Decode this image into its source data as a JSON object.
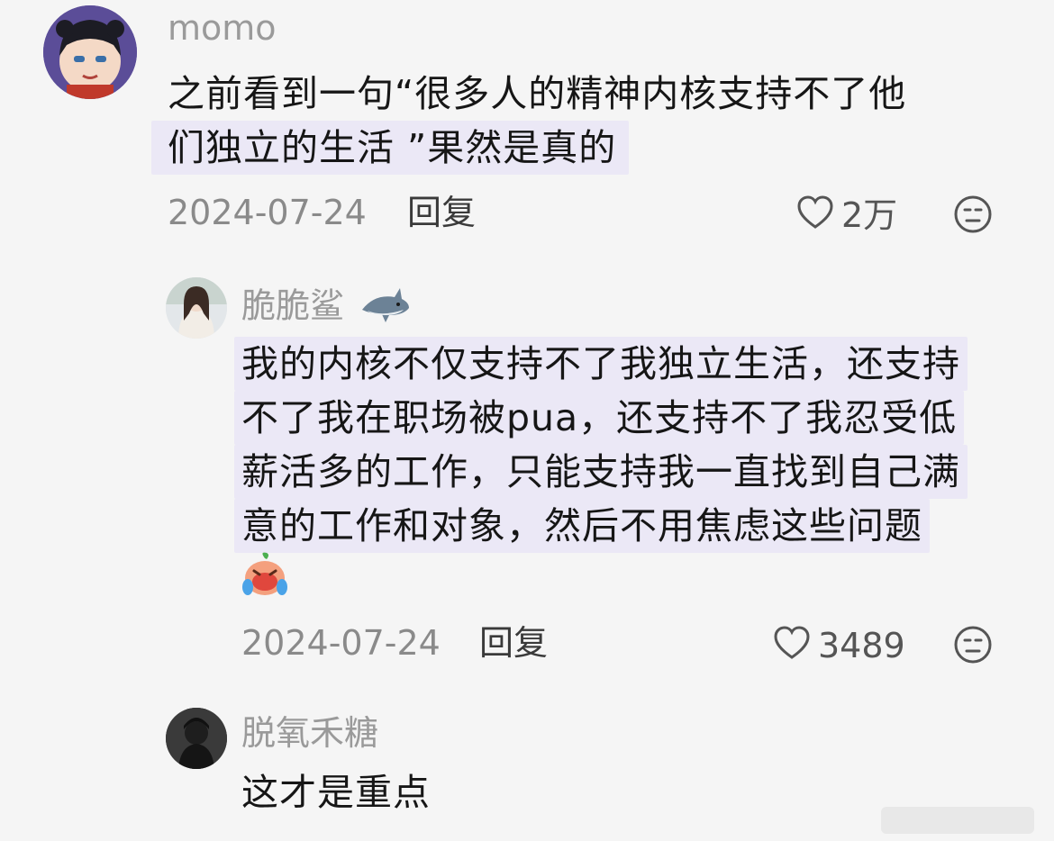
{
  "comments": [
    {
      "username": "momo",
      "lines": [
        "之前看到一句“很多人的精神内核支持不了他",
        "们独立的生活 ”果然是真的"
      ],
      "date": "2024-07-24",
      "reply_label": "回复",
      "likes": "2万"
    },
    {
      "username": "脆脆鲨",
      "lines": [
        "我的内核不仅支持不了我独立生活，还支持",
        "不了我在职场被pua，还支持不了我忍受低",
        "薪活多的工作，只能支持我一直找到自己满",
        "意的工作和对象，然后不用焦虑这些问题"
      ],
      "date": "2024-07-24",
      "reply_label": "回复",
      "likes": "3489"
    },
    {
      "username": "脱氧禾糖",
      "lines": [
        "这才是重点"
      ]
    }
  ],
  "icons": {
    "like": "heart-outline-icon",
    "reaction": "neutral-face-icon",
    "sticker": "crying-peach-emoji",
    "username_badge": "shark-emoji"
  },
  "colors": {
    "background": "#f5f5f5",
    "highlight": "#ebe8f6",
    "username": "#9a9a9a",
    "meta": "#8a8a8a"
  }
}
